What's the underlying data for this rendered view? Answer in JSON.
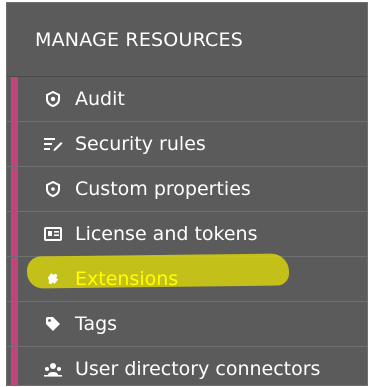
{
  "panel": {
    "title": "MANAGE RESOURCES",
    "accent_color": "#c0457b",
    "highlight_color": "#ece800",
    "items": [
      {
        "label": "Audit",
        "icon": "audit-shield-icon"
      },
      {
        "label": "Security rules",
        "icon": "security-rules-icon"
      },
      {
        "label": "Custom properties",
        "icon": "custom-properties-icon"
      },
      {
        "label": "License and tokens",
        "icon": "license-card-icon"
      },
      {
        "label": "Extensions",
        "icon": "puzzle-extension-icon",
        "highlighted": true
      },
      {
        "label": "Tags",
        "icon": "tag-icon"
      },
      {
        "label": "User directory connectors",
        "icon": "user-directory-icon"
      }
    ]
  }
}
